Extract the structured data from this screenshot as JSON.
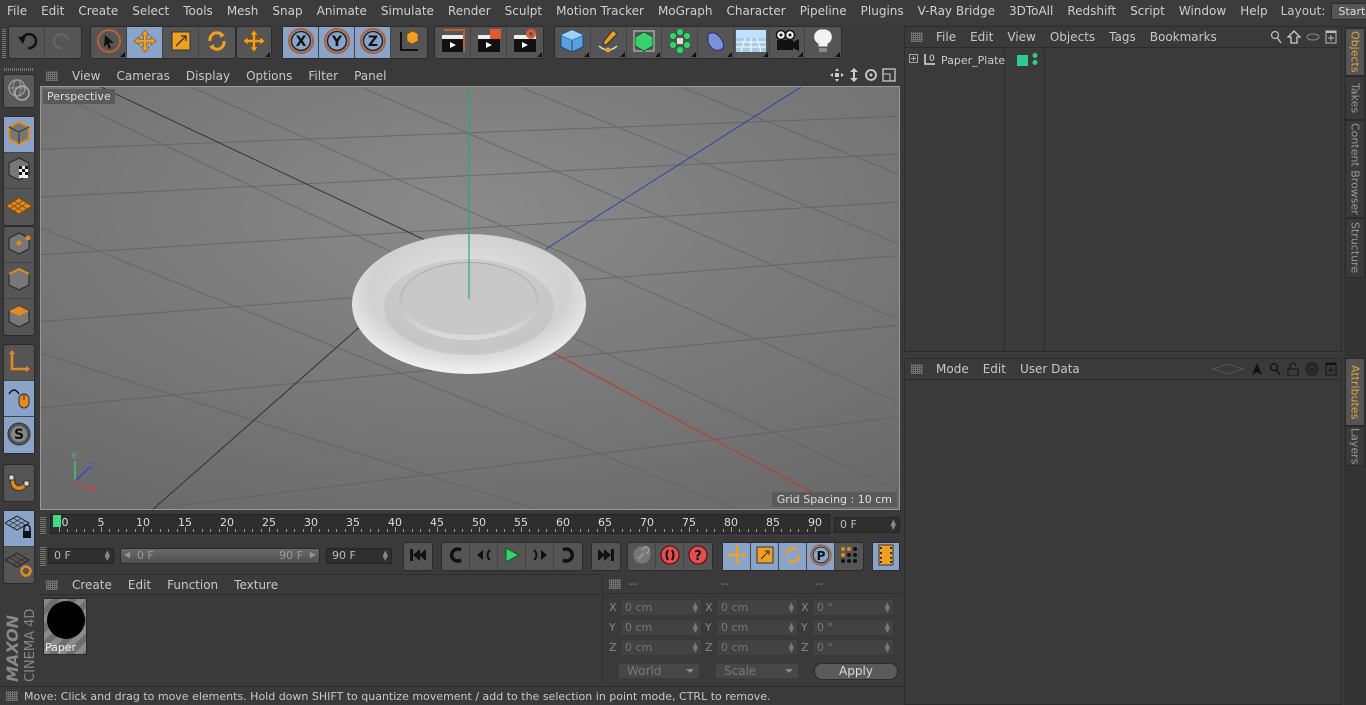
{
  "menubar": {
    "items": [
      "File",
      "Edit",
      "Create",
      "Select",
      "Tools",
      "Mesh",
      "Snap",
      "Animate",
      "Simulate",
      "Render",
      "Sculpt",
      "Motion Tracker",
      "MoGraph",
      "Character",
      "Pipeline",
      "Plugins",
      "V-Ray Bridge",
      "3DToAll",
      "Redshift",
      "Script",
      "Window",
      "Help"
    ],
    "layout_label": "Layout:",
    "layout_value": "Startup"
  },
  "toolbar": {
    "groups": [
      {
        "tools": [
          {
            "icon": "undo-icon"
          },
          {
            "icon": "redo-icon",
            "disabled": true
          }
        ]
      },
      {
        "tools": [
          {
            "icon": "live-selection-icon"
          },
          {
            "icon": "move-icon",
            "active": true
          },
          {
            "icon": "scale-icon"
          },
          {
            "icon": "rotate-icon"
          }
        ]
      },
      {
        "tools": [
          {
            "icon": "recent-tools-icon"
          }
        ]
      },
      {
        "tools": [
          {
            "icon": "x-axis-lock-icon",
            "label": "X",
            "active": true
          },
          {
            "icon": "y-axis-lock-icon",
            "label": "Y",
            "active": true
          },
          {
            "icon": "z-axis-lock-icon",
            "label": "Z",
            "active": true
          },
          {
            "icon": "coordinate-system-icon"
          }
        ]
      },
      {
        "tools": [
          {
            "icon": "render-region-icon"
          },
          {
            "icon": "render-view-icon"
          },
          {
            "icon": "render-settings-icon"
          }
        ]
      },
      {
        "tools": [
          {
            "icon": "cube-primitive-icon"
          },
          {
            "icon": "pen-spline-icon"
          },
          {
            "icon": "subdivision-surface-icon"
          },
          {
            "icon": "cloner-icon"
          },
          {
            "icon": "deformer-icon"
          },
          {
            "icon": "floor-icon"
          },
          {
            "icon": "camera-icon"
          },
          {
            "icon": "light-icon"
          }
        ]
      }
    ]
  },
  "left_tools": [
    {
      "icon": "model-mode-icon",
      "active": true
    },
    {
      "icon": "texture-mode-icon"
    },
    {
      "icon": "workplane-mode-icon"
    },
    {
      "icon": "points-mode-icon"
    },
    {
      "icon": "edges-mode-icon"
    },
    {
      "icon": "polygons-mode-icon"
    },
    {
      "icon": "axis-mode-icon"
    },
    {
      "icon": "tweak-mode-icon",
      "active": true
    },
    {
      "icon": "solo-mode-icon",
      "active": true
    },
    {
      "icon": "snap-magnet-icon"
    },
    {
      "icon": "workplane-lock-icon",
      "active": true
    },
    {
      "icon": "workplane-align-icon"
    }
  ],
  "viewport": {
    "menu": [
      "View",
      "Cameras",
      "Display",
      "Options",
      "Filter",
      "Panel"
    ],
    "label": "Perspective",
    "grid_spacing": "Grid Spacing : 10 cm",
    "axis_labels": {
      "x": "X",
      "y": "Y",
      "z": "Z"
    },
    "colors": {
      "x_axis": "#c0392b",
      "y_axis": "#27ae60",
      "z_axis": "#3b3bb0"
    }
  },
  "timeline": {
    "ticks": [
      0,
      5,
      10,
      15,
      20,
      25,
      30,
      35,
      40,
      45,
      50,
      55,
      60,
      65,
      70,
      75,
      80,
      85,
      90
    ],
    "current_frame": "0 F",
    "current_frame_value": 0,
    "max_frame": 90,
    "playhead_color": "#3ddc84"
  },
  "transport": {
    "start_field": "0 F",
    "range_start": "0 F",
    "range_end": "90 F",
    "end_field": "90 F"
  },
  "material_manager": {
    "menu": [
      "Create",
      "Edit",
      "Function",
      "Texture"
    ],
    "materials": [
      {
        "name": "Paper",
        "color": "#000000"
      }
    ]
  },
  "coordinates": {
    "headers": [
      "--",
      "--",
      "--"
    ],
    "rows": [
      {
        "axis": "X",
        "pos": "0 cm",
        "size": "0 cm",
        "rot": "0 °"
      },
      {
        "axis": "Y",
        "pos": "0 cm",
        "size": "0 cm",
        "rot": "0 °"
      },
      {
        "axis": "Z",
        "pos": "0 cm",
        "size": "0 cm",
        "rot": "0 °"
      }
    ],
    "space": "World",
    "mode": "Scale",
    "apply_label": "Apply"
  },
  "status": {
    "message": "Move: Click and drag to move elements. Hold down SHIFT to quantize movement / add to the selection in point mode, CTRL to remove."
  },
  "object_manager": {
    "menu": [
      "File",
      "Edit",
      "View",
      "Objects",
      "Tags",
      "Bookmarks"
    ],
    "objects": [
      {
        "name": "Paper_Plate",
        "layer_color": "#2ecc8a"
      }
    ]
  },
  "attribute_manager": {
    "menu": [
      "Mode",
      "Edit",
      "User Data"
    ]
  },
  "side_tabs": {
    "top": [
      {
        "label": "Objects",
        "active": true
      },
      {
        "label": "Takes"
      },
      {
        "label": "Content Browser"
      },
      {
        "label": "Structure"
      }
    ],
    "bottom": [
      {
        "label": "Attributes",
        "active": true
      },
      {
        "label": "Layers"
      }
    ]
  },
  "branding": {
    "maxon": "MAXON",
    "product": "CINEMA 4D"
  }
}
